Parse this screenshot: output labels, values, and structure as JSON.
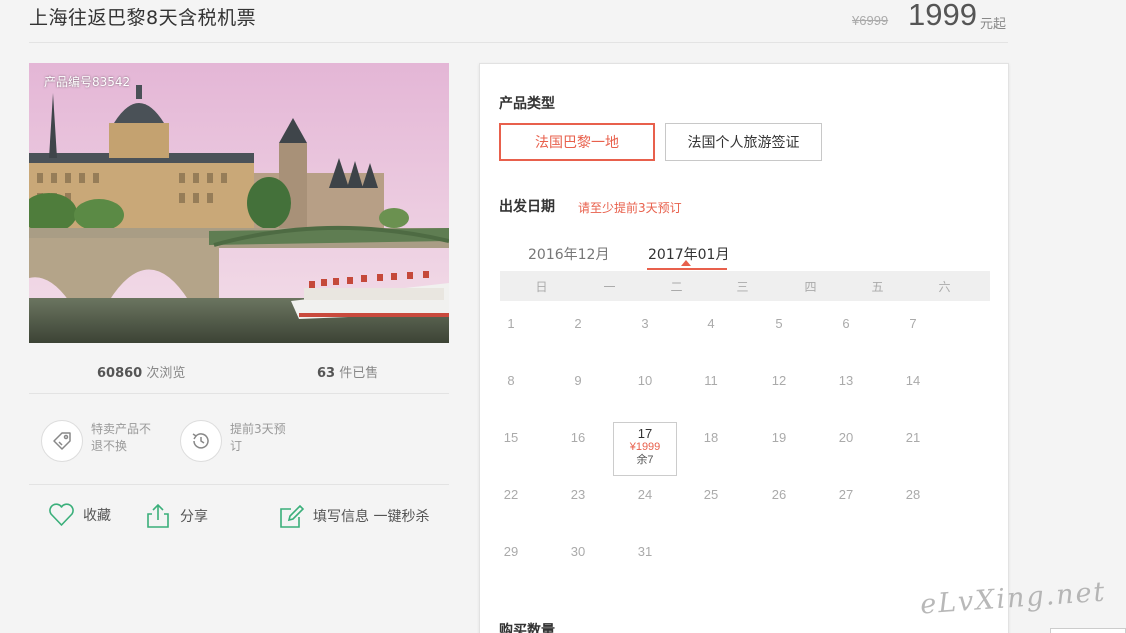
{
  "header": {
    "title": "上海往返巴黎8天含税机票",
    "original_price": "¥6999",
    "price": "1999",
    "price_unit": "元起"
  },
  "photo": {
    "product_code": "产品编号83542"
  },
  "stats": {
    "views_count": "60860",
    "views_label": "次浏览",
    "sold_count": "63",
    "sold_label": "件已售"
  },
  "badges": [
    {
      "icon": "tag-icon",
      "text": "特卖产品不退不换"
    },
    {
      "icon": "clock-history-icon",
      "text": "提前3天预订"
    }
  ],
  "actions": {
    "favorite": "收藏",
    "share": "分享",
    "fill_info": "填写信息 一键秒杀"
  },
  "booking": {
    "product_type_label": "产品类型",
    "types": [
      "法国巴黎一地",
      "法国个人旅游签证"
    ],
    "selected_type": 0,
    "departure_label": "出发日期",
    "departure_hint": "请至少提前3天预订",
    "months": [
      "2016年12月",
      "2017年01月"
    ],
    "selected_month": 1,
    "weekdays": [
      "日",
      "一",
      "二",
      "三",
      "四",
      "五",
      "六"
    ],
    "days": [
      [
        "1",
        "2",
        "3",
        "4",
        "5",
        "6",
        "7"
      ],
      [
        "8",
        "9",
        "10",
        "11",
        "12",
        "13",
        "14"
      ],
      [
        "15",
        "16",
        "17",
        "18",
        "19",
        "20",
        "21"
      ],
      [
        "22",
        "23",
        "24",
        "25",
        "26",
        "27",
        "28"
      ],
      [
        "29",
        "30",
        "31"
      ]
    ],
    "selected_day": {
      "day": "17",
      "price": "¥1999",
      "stock": "余7"
    },
    "quantity_label": "购买数量"
  },
  "watermark": "eLvXing.net",
  "colors": {
    "accent": "#e8604c",
    "icon_green": "#3aaf7a"
  }
}
